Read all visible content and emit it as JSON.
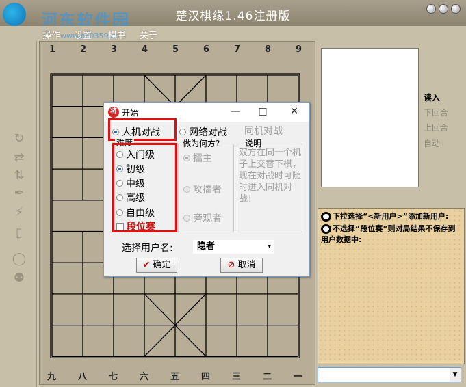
{
  "window": {
    "title": "楚汉棋缘1.46注册版"
  },
  "watermark": {
    "text": "河东软件园",
    "url": "www.pc0359.cn"
  },
  "menu": [
    "操作",
    "设置",
    "棋书",
    "关于"
  ],
  "board": {
    "top_numbers": [
      "1",
      "2",
      "3",
      "4",
      "5",
      "6",
      "7",
      "8",
      "9"
    ],
    "bottom_numbers": [
      "九",
      "八",
      "七",
      "六",
      "五",
      "四",
      "三",
      "二",
      "一"
    ]
  },
  "right_panel": {
    "read_label": "读入",
    "next_round": "下回合",
    "prev_round": "上回合",
    "auto": "自动",
    "note1": "下拉选择“<新用户>”添加新用户:",
    "note2": "不选择“段位赛”则对局结果不保存到用户数据中:"
  },
  "dialog": {
    "title": "开始",
    "icon_text": "将",
    "mode_human_ai": "人机对战",
    "mode_network": "网络对战",
    "mode_local": "同机对战",
    "group_level": "难度",
    "levels": [
      "入门级",
      "初级",
      "中级",
      "高级",
      "自由级"
    ],
    "ranked_label": "段位赛",
    "group_role": "做为何方?",
    "roles": [
      "擂主",
      "攻擂者",
      "旁观者"
    ],
    "group_desc": "说明",
    "description": "双方在同一个机子上交替下棋，现在对战时可随时进入同机对战！",
    "user_label": "选择用户名:",
    "user_value": "隐者",
    "ok_label": "确定",
    "cancel_label": "取消",
    "selected_level": "初级"
  },
  "colors": {
    "highlight_box": "#e01010",
    "ranked_text": "#cc1010"
  }
}
